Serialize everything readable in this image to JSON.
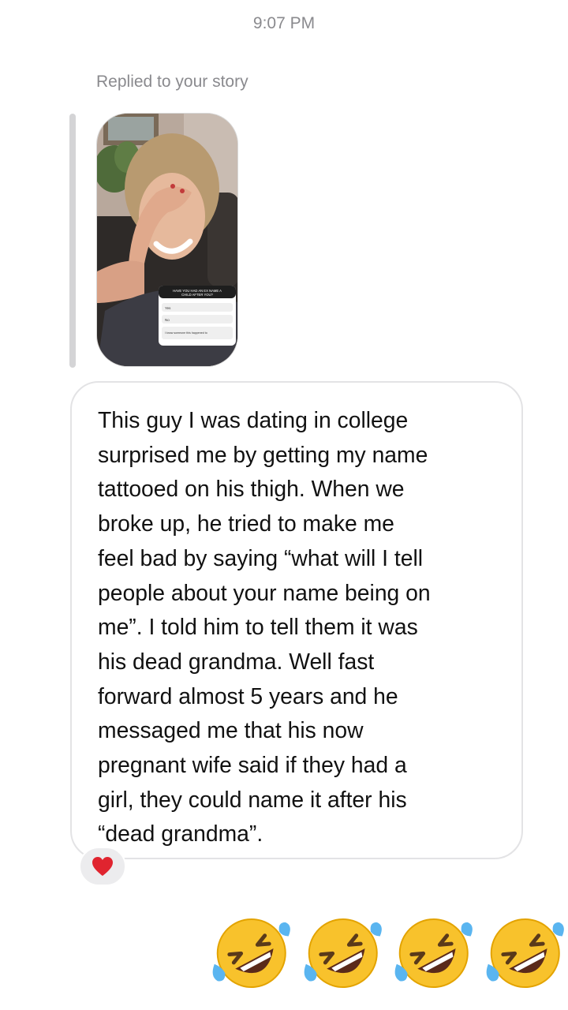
{
  "header": {
    "timestamp": "9:07 PM"
  },
  "story_reply": {
    "label": "Replied to your story",
    "thumbnail": {
      "poll_question": "HAVE YOU HAD AN EX NAME A CHILD AFTER YOU?",
      "poll_options": [
        "Yes",
        "No",
        "I know someone this happened to"
      ]
    }
  },
  "message": {
    "text": "This guy I was dating in college\nsurprised me by getting my name\ntattooed on his thigh. When we\nbroke up, he tried to make me\nfeel bad by saying “what will I tell\npeople about your name being on\nme”. I told him to tell them it was\nhis dead grandma. Well fast\nforward almost 5 years and he\nmessaged me that his now\npregnant wife said if they had a\ngirl, they could name it after his\n“dead grandma”.",
    "reaction": "heart-icon",
    "reaction_color": "#e0242f"
  },
  "emoji_reply": {
    "emojis": [
      "rolling-on-floor-laughing",
      "rolling-on-floor-laughing",
      "rolling-on-floor-laughing",
      "rolling-on-floor-laughing"
    ]
  },
  "colors": {
    "meta_text": "#8a8a8e",
    "bubble_border": "#e3e3e5",
    "reply_bar": "#d4d4d6"
  }
}
